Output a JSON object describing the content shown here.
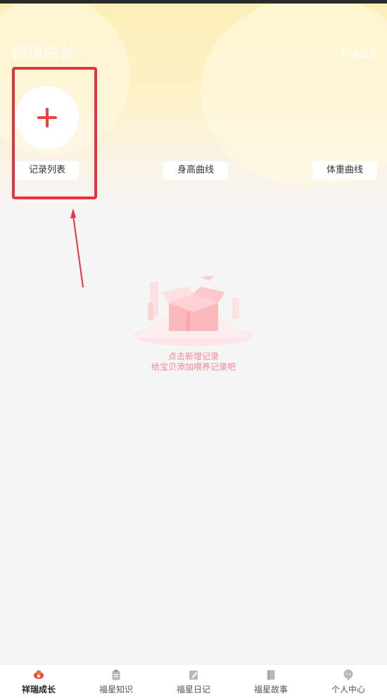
{
  "header": {
    "title": "祥瑞成长",
    "right_link": "新增记录"
  },
  "actions": {
    "add_label": "+",
    "record_list": "记录列表",
    "height_curve": "身高曲线",
    "weight_curve": "体重曲线"
  },
  "empty_state": {
    "line1": "点击新增记录",
    "line2": "给宝贝添加喂养记录吧"
  },
  "tabs": [
    {
      "label": "祥瑞成长",
      "icon": "growth-icon",
      "active": true
    },
    {
      "label": "福星知识",
      "icon": "clipboard-icon",
      "active": false
    },
    {
      "label": "福星日记",
      "icon": "note-icon",
      "active": false
    },
    {
      "label": "福星故事",
      "icon": "book-icon",
      "active": false
    },
    {
      "label": "个人中心",
      "icon": "profile-icon",
      "active": false
    }
  ],
  "colors": {
    "accent_red": "#ee4338",
    "highlight_red": "#e8333f",
    "empty_text": "#f4888e",
    "header_yellow": "#fdefb8"
  }
}
